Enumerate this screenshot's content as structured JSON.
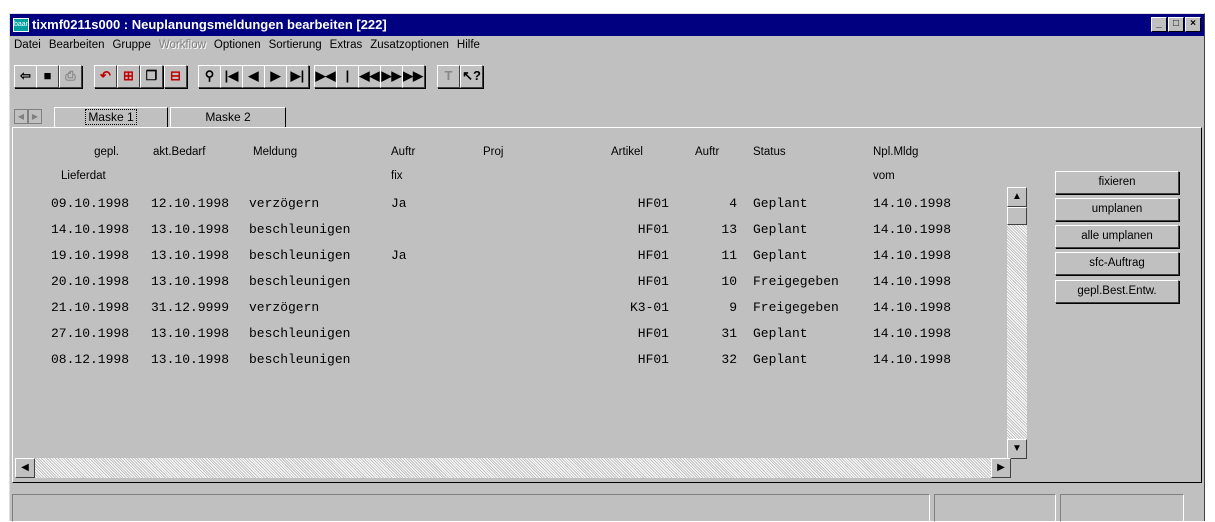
{
  "window": {
    "title": "tixmf0211s000 : Neuplanungsmeldungen bearbeiten [222]",
    "app_icon_text": "baan",
    "controls": [
      "_",
      "□",
      "×"
    ]
  },
  "menu": [
    {
      "label": "Datei",
      "enabled": true
    },
    {
      "label": "Bearbeiten",
      "enabled": true
    },
    {
      "label": "Gruppe",
      "enabled": true
    },
    {
      "label": "Workflow",
      "enabled": false
    },
    {
      "label": "Optionen",
      "enabled": true
    },
    {
      "label": "Sortierung",
      "enabled": true
    },
    {
      "label": "Extras",
      "enabled": true
    },
    {
      "label": "Zusatzoptionen",
      "enabled": true
    },
    {
      "label": "Hilfe",
      "enabled": true
    }
  ],
  "toolbar": [
    {
      "name": "exit-icon",
      "glyph": "⇦"
    },
    {
      "name": "save-icon",
      "glyph": "■"
    },
    {
      "name": "print-icon",
      "glyph": "⎙"
    },
    {
      "name": "undo-icon",
      "glyph": "↶"
    },
    {
      "name": "insert-record-icon",
      "glyph": "⊞"
    },
    {
      "name": "copy-record-icon",
      "glyph": "❐"
    },
    {
      "name": "delete-record-icon",
      "glyph": "⊟"
    },
    {
      "name": "find-icon",
      "glyph": "⚲"
    },
    {
      "name": "first-record-icon",
      "glyph": "|◀"
    },
    {
      "name": "previous-record-icon",
      "glyph": "◀"
    },
    {
      "name": "next-record-icon",
      "glyph": "▶"
    },
    {
      "name": "last-record-icon",
      "glyph": "▶|"
    },
    {
      "name": "previous-set-icon",
      "glyph": "▶◀"
    },
    {
      "name": "first-set-icon",
      "glyph": "|◀◀"
    },
    {
      "name": "previous-page-icon",
      "glyph": "◀◀"
    },
    {
      "name": "next-page-icon",
      "glyph": "▶▶"
    },
    {
      "name": "last-page-icon",
      "glyph": "▶▶|"
    },
    {
      "name": "text-icon",
      "glyph": "T"
    },
    {
      "name": "context-help-icon",
      "glyph": "↖?"
    }
  ],
  "tabs": [
    {
      "label": "Maske 1",
      "active": true
    },
    {
      "label": "Maske 2",
      "active": false
    }
  ],
  "table": {
    "headers_line1": [
      "gepl.",
      "akt.Bedarf",
      "Meldung",
      "Auftr",
      "Proj",
      "Artikel",
      "Auftr",
      "Status",
      "Npl.Mldg"
    ],
    "headers_line2": [
      "Lieferdat",
      "",
      "",
      "fix",
      "",
      "",
      "",
      "",
      "vom"
    ],
    "rows": [
      [
        "09.10.1998",
        "12.10.1998",
        "verzögern",
        "Ja",
        "",
        "HF01",
        "4",
        "Geplant",
        "14.10.1998"
      ],
      [
        "14.10.1998",
        "13.10.1998",
        "beschleunigen",
        "",
        "",
        "HF01",
        "13",
        "Geplant",
        "14.10.1998"
      ],
      [
        "19.10.1998",
        "13.10.1998",
        "beschleunigen",
        "Ja",
        "",
        "HF01",
        "11",
        "Geplant",
        "14.10.1998"
      ],
      [
        "20.10.1998",
        "13.10.1998",
        "beschleunigen",
        "",
        "",
        "HF01",
        "10",
        "Freigegeben",
        "14.10.1998"
      ],
      [
        "21.10.1998",
        "31.12.9999",
        "verzögern",
        "",
        "",
        "K3-01",
        "9",
        "Freigegeben",
        "14.10.1998"
      ],
      [
        "27.10.1998",
        "13.10.1998",
        "beschleunigen",
        "",
        "",
        "HF01",
        "31",
        "Geplant",
        "14.10.1998"
      ],
      [
        "08.12.1998",
        "13.10.1998",
        "beschleunigen",
        "",
        "",
        "HF01",
        "32",
        "Geplant",
        "14.10.1998"
      ]
    ]
  },
  "side_buttons": [
    "fixieren",
    "umplanen",
    "alle umplanen",
    "sfc-Auftrag",
    "gepl.Best.Entw."
  ],
  "scroll": {
    "up": "▲",
    "down": "▼",
    "left": "◀",
    "right": "▶"
  },
  "status": [
    "",
    "",
    ""
  ]
}
